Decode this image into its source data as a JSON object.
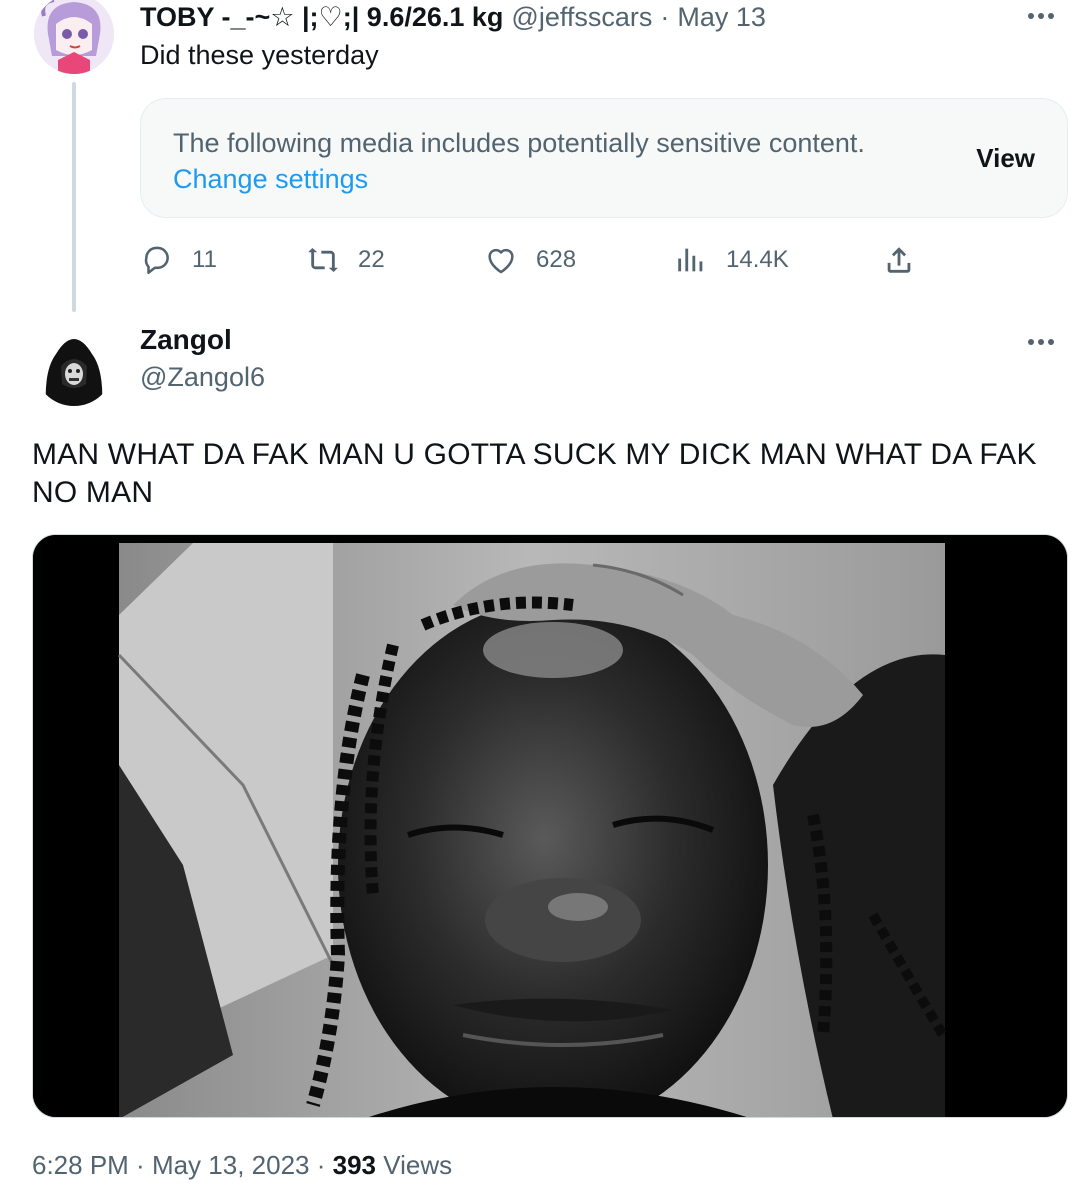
{
  "reply_context": {
    "author_name": "TOBY -_-~☆ |;♡;| 9.6/26.1 kg",
    "author_handle": "@jeffsscars",
    "separator": "·",
    "date": "May 13",
    "text": "Did these yesterday",
    "sensitive_notice": {
      "message": "The following media includes potentially sensitive content.",
      "settings_link": "Change settings",
      "view_button": "View"
    },
    "actions": {
      "replies": "11",
      "reposts": "22",
      "likes": "628",
      "views": "14.4K"
    }
  },
  "main_tweet": {
    "author_name": "Zangol",
    "author_handle": "@Zangol6",
    "text": "MAN WHAT DA FAK MAN U GOTTA SUCK MY DICK MAN WHAT DA FAK NO MAN",
    "timestamp": {
      "time": "6:28 PM",
      "separator1": " · ",
      "date": "May 13, 2023",
      "separator2": " · ",
      "views_count": "393",
      "views_label": " Views"
    }
  },
  "colors": {
    "text_primary": "#0f1419",
    "text_secondary": "#536471",
    "link": "#1d9bf0",
    "thread_line": "#cfd9de"
  }
}
